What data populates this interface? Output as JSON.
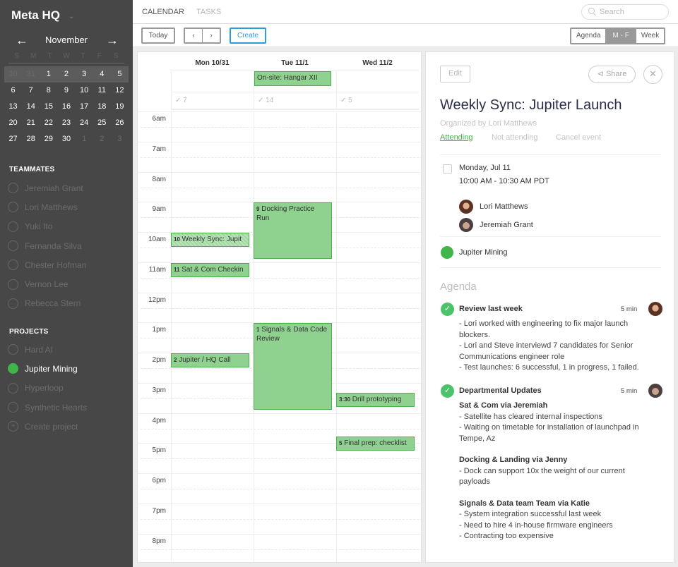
{
  "sidebar": {
    "org_name": "Meta HQ",
    "month": "November",
    "weekdays": [
      "S",
      "M",
      "T",
      "W",
      "T",
      "F",
      "S"
    ],
    "weeks": [
      [
        {
          "d": "30",
          "dim": true
        },
        {
          "d": "31",
          "dim": true
        },
        {
          "d": "1"
        },
        {
          "d": "2"
        },
        {
          "d": "3"
        },
        {
          "d": "4"
        },
        {
          "d": "5"
        }
      ],
      [
        {
          "d": "6"
        },
        {
          "d": "7"
        },
        {
          "d": "8"
        },
        {
          "d": "9"
        },
        {
          "d": "10"
        },
        {
          "d": "11"
        },
        {
          "d": "12"
        }
      ],
      [
        {
          "d": "13"
        },
        {
          "d": "14"
        },
        {
          "d": "15"
        },
        {
          "d": "16"
        },
        {
          "d": "17"
        },
        {
          "d": "18"
        },
        {
          "d": "19"
        }
      ],
      [
        {
          "d": "20"
        },
        {
          "d": "21"
        },
        {
          "d": "22"
        },
        {
          "d": "23"
        },
        {
          "d": "24"
        },
        {
          "d": "25"
        },
        {
          "d": "26"
        }
      ],
      [
        {
          "d": "27"
        },
        {
          "d": "28"
        },
        {
          "d": "29"
        },
        {
          "d": "30"
        },
        {
          "d": "1",
          "dim": true
        },
        {
          "d": "2",
          "dim": true
        },
        {
          "d": "3",
          "dim": true
        }
      ]
    ],
    "teammates_heading": "TEAMMATES",
    "teammates": [
      "Jeremiah Grant",
      "Lori Matthews",
      "Yuki Ito",
      "Fernanda Silva",
      "Chester Hofman",
      "Vernon Lee",
      "Rebecca Stern"
    ],
    "projects_heading": "PROJECTS",
    "projects": [
      {
        "label": "Hard AI",
        "active": false
      },
      {
        "label": "Jupiter Mining",
        "active": true
      },
      {
        "label": "Hyperloop",
        "active": false
      },
      {
        "label": "Synthetic Hearts",
        "active": false
      }
    ],
    "create_project": "Create project"
  },
  "topbar": {
    "tab_calendar": "CALENDAR",
    "tab_tasks": "TASKS",
    "search_placeholder": "Search"
  },
  "toolbar": {
    "today": "Today",
    "prev": "‹",
    "next": "›",
    "create": "Create",
    "views": [
      "Agenda",
      "M - F",
      "Week"
    ],
    "active_view": "M - F"
  },
  "calendar": {
    "days": [
      "Mon 10/31",
      "Tue 11/1",
      "Wed 11/2"
    ],
    "task_counts": [
      "7",
      "14",
      "5"
    ],
    "allday_events": [
      {
        "day": 1,
        "title": "On-site: Hangar XII"
      }
    ],
    "hours": [
      "6am",
      "7am",
      "8am",
      "9am",
      "10am",
      "11am",
      "12pm",
      "1pm",
      "2pm",
      "3pm",
      "4pm",
      "5pm",
      "6pm",
      "7pm",
      "8pm"
    ],
    "events": [
      {
        "day": 1,
        "start": 9,
        "end": 10.9,
        "time": "9",
        "title": "Docking Practice Run",
        "wrap": true
      },
      {
        "day": 0,
        "start": 10,
        "end": 10.5,
        "time": "10",
        "title": "Weekly Sync: Jupit",
        "hatched": true
      },
      {
        "day": 0,
        "start": 11,
        "end": 11.5,
        "time": "11",
        "title": "Sat & Com Checkin"
      },
      {
        "day": 1,
        "start": 13,
        "end": 15.9,
        "time": "1",
        "title": "Signals & Data Code Review",
        "wrap": true
      },
      {
        "day": 0,
        "start": 14,
        "end": 14.5,
        "time": "2",
        "title": "Jupiter / HQ Call"
      },
      {
        "day": 2,
        "start": 15.3,
        "end": 15.8,
        "time": "3:30",
        "title": "Drill prototyping"
      },
      {
        "day": 2,
        "start": 16.75,
        "end": 17.25,
        "time": "5",
        "title": "Final prep: checklist"
      }
    ],
    "event_color": "#8fd18f"
  },
  "detail": {
    "edit": "Edit",
    "share": "Share",
    "title": "Weekly Sync: Jupiter Launch",
    "organizer": "Organized by Lori Matthews",
    "rsvp": {
      "attending": "Attending",
      "not_attending": "Not attending",
      "cancel": "Cancel event"
    },
    "date": "Monday, Jul 11",
    "time": "10:00 AM - 10:30 AM PDT",
    "attendees": [
      "Lori Matthews",
      "Jeremiah Grant"
    ],
    "project": "Jupiter Mining",
    "project_color": "#3fb54a",
    "agenda_heading": "Agenda",
    "agenda": [
      {
        "title": "Review last week",
        "duration": "5 min",
        "lines": [
          "- Lori worked with engineering to fix major launch blockers.",
          "- Lori and Steve interviewd 7 candidates for Senior Communications engineer role",
          "- Test launches: 6 successful, 1 in progress, 1 failed."
        ]
      },
      {
        "title": "Departmental Updates",
        "duration": "5 min",
        "groups": [
          {
            "sub": "Sat & Com via Jeremiah",
            "lines": [
              "- Satellite has cleared internal inspections",
              "- Waiting on timetable for installation of launchpad in Tempe, Az"
            ]
          },
          {
            "sub": "Docking & Landing via Jenny",
            "lines": [
              "- Dock can support 10x the weight of our current payloads"
            ]
          },
          {
            "sub": "Signals & Data team Team via Katie",
            "lines": [
              "- System integration successful last week",
              "- Need to hire 4 in-house firmware engineers",
              "- Contracting too expensive"
            ]
          }
        ]
      }
    ]
  }
}
